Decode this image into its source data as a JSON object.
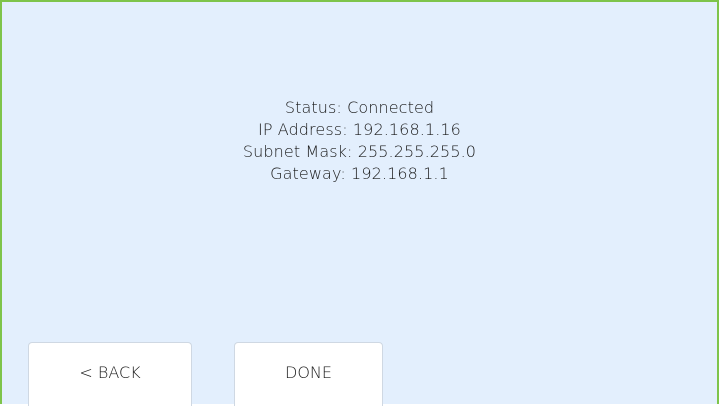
{
  "status": {
    "status_line": "Status: Connected",
    "ip_line": "IP Address: 192.168.1.16",
    "subnet_line": "Subnet Mask: 255.255.255.0",
    "gateway_line": "Gateway: 192.168.1.1"
  },
  "buttons": {
    "back_label": "< BACK",
    "done_label": "DONE"
  },
  "colors": {
    "background": "#e3effd",
    "border": "#7ec44b",
    "button_bg": "#ffffff"
  }
}
